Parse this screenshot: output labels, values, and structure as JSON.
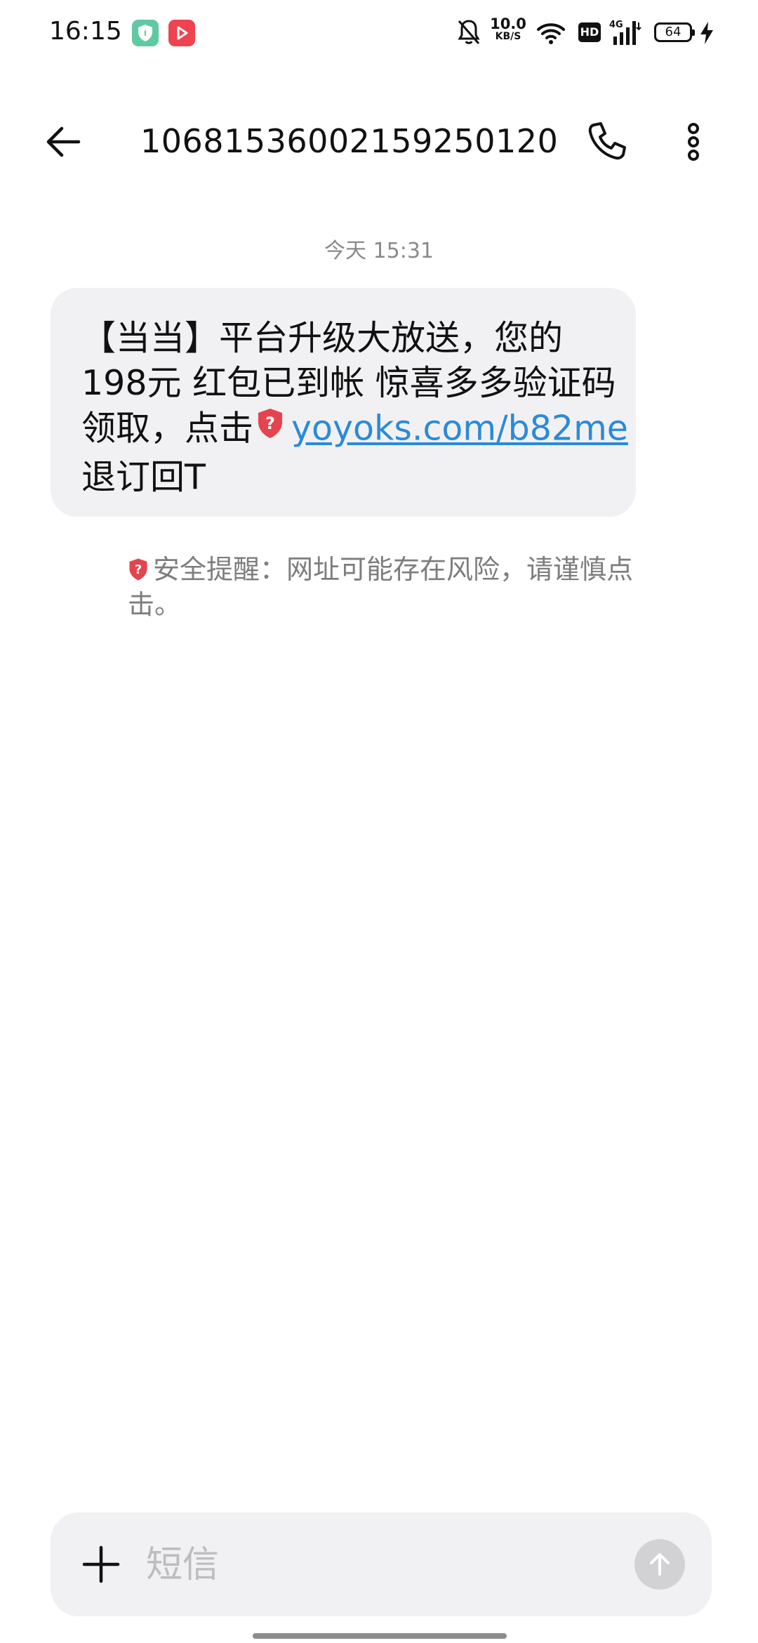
{
  "status_bar": {
    "time": "16:15",
    "app_icons": [
      "shield-app-icon",
      "video-app-icon"
    ],
    "net_speed_value": "10.0",
    "net_speed_unit": "KB/S",
    "network_label": "4G",
    "hd_label": "HD",
    "battery_level": "64"
  },
  "header": {
    "title": "10681536002159250120"
  },
  "conversation": {
    "timestamp": "今天 15:31",
    "message": {
      "line1": "【当当】平台升级大放送，您的",
      "line2": "198元 红包已到帐 惊喜多多验证码",
      "line3_prefix": "领取，点击",
      "link": "yoyoks.com/b82me",
      "line4": "退订回T"
    },
    "security_warning": "安全提醒：网址可能存在风险，请谨慎点击。"
  },
  "composer": {
    "placeholder": "短信"
  },
  "colors": {
    "link": "#2b8ad8",
    "warning_shield": "#e5434e",
    "bubble_bg": "#f1f1f3",
    "send_button": "#d2d2d4"
  }
}
